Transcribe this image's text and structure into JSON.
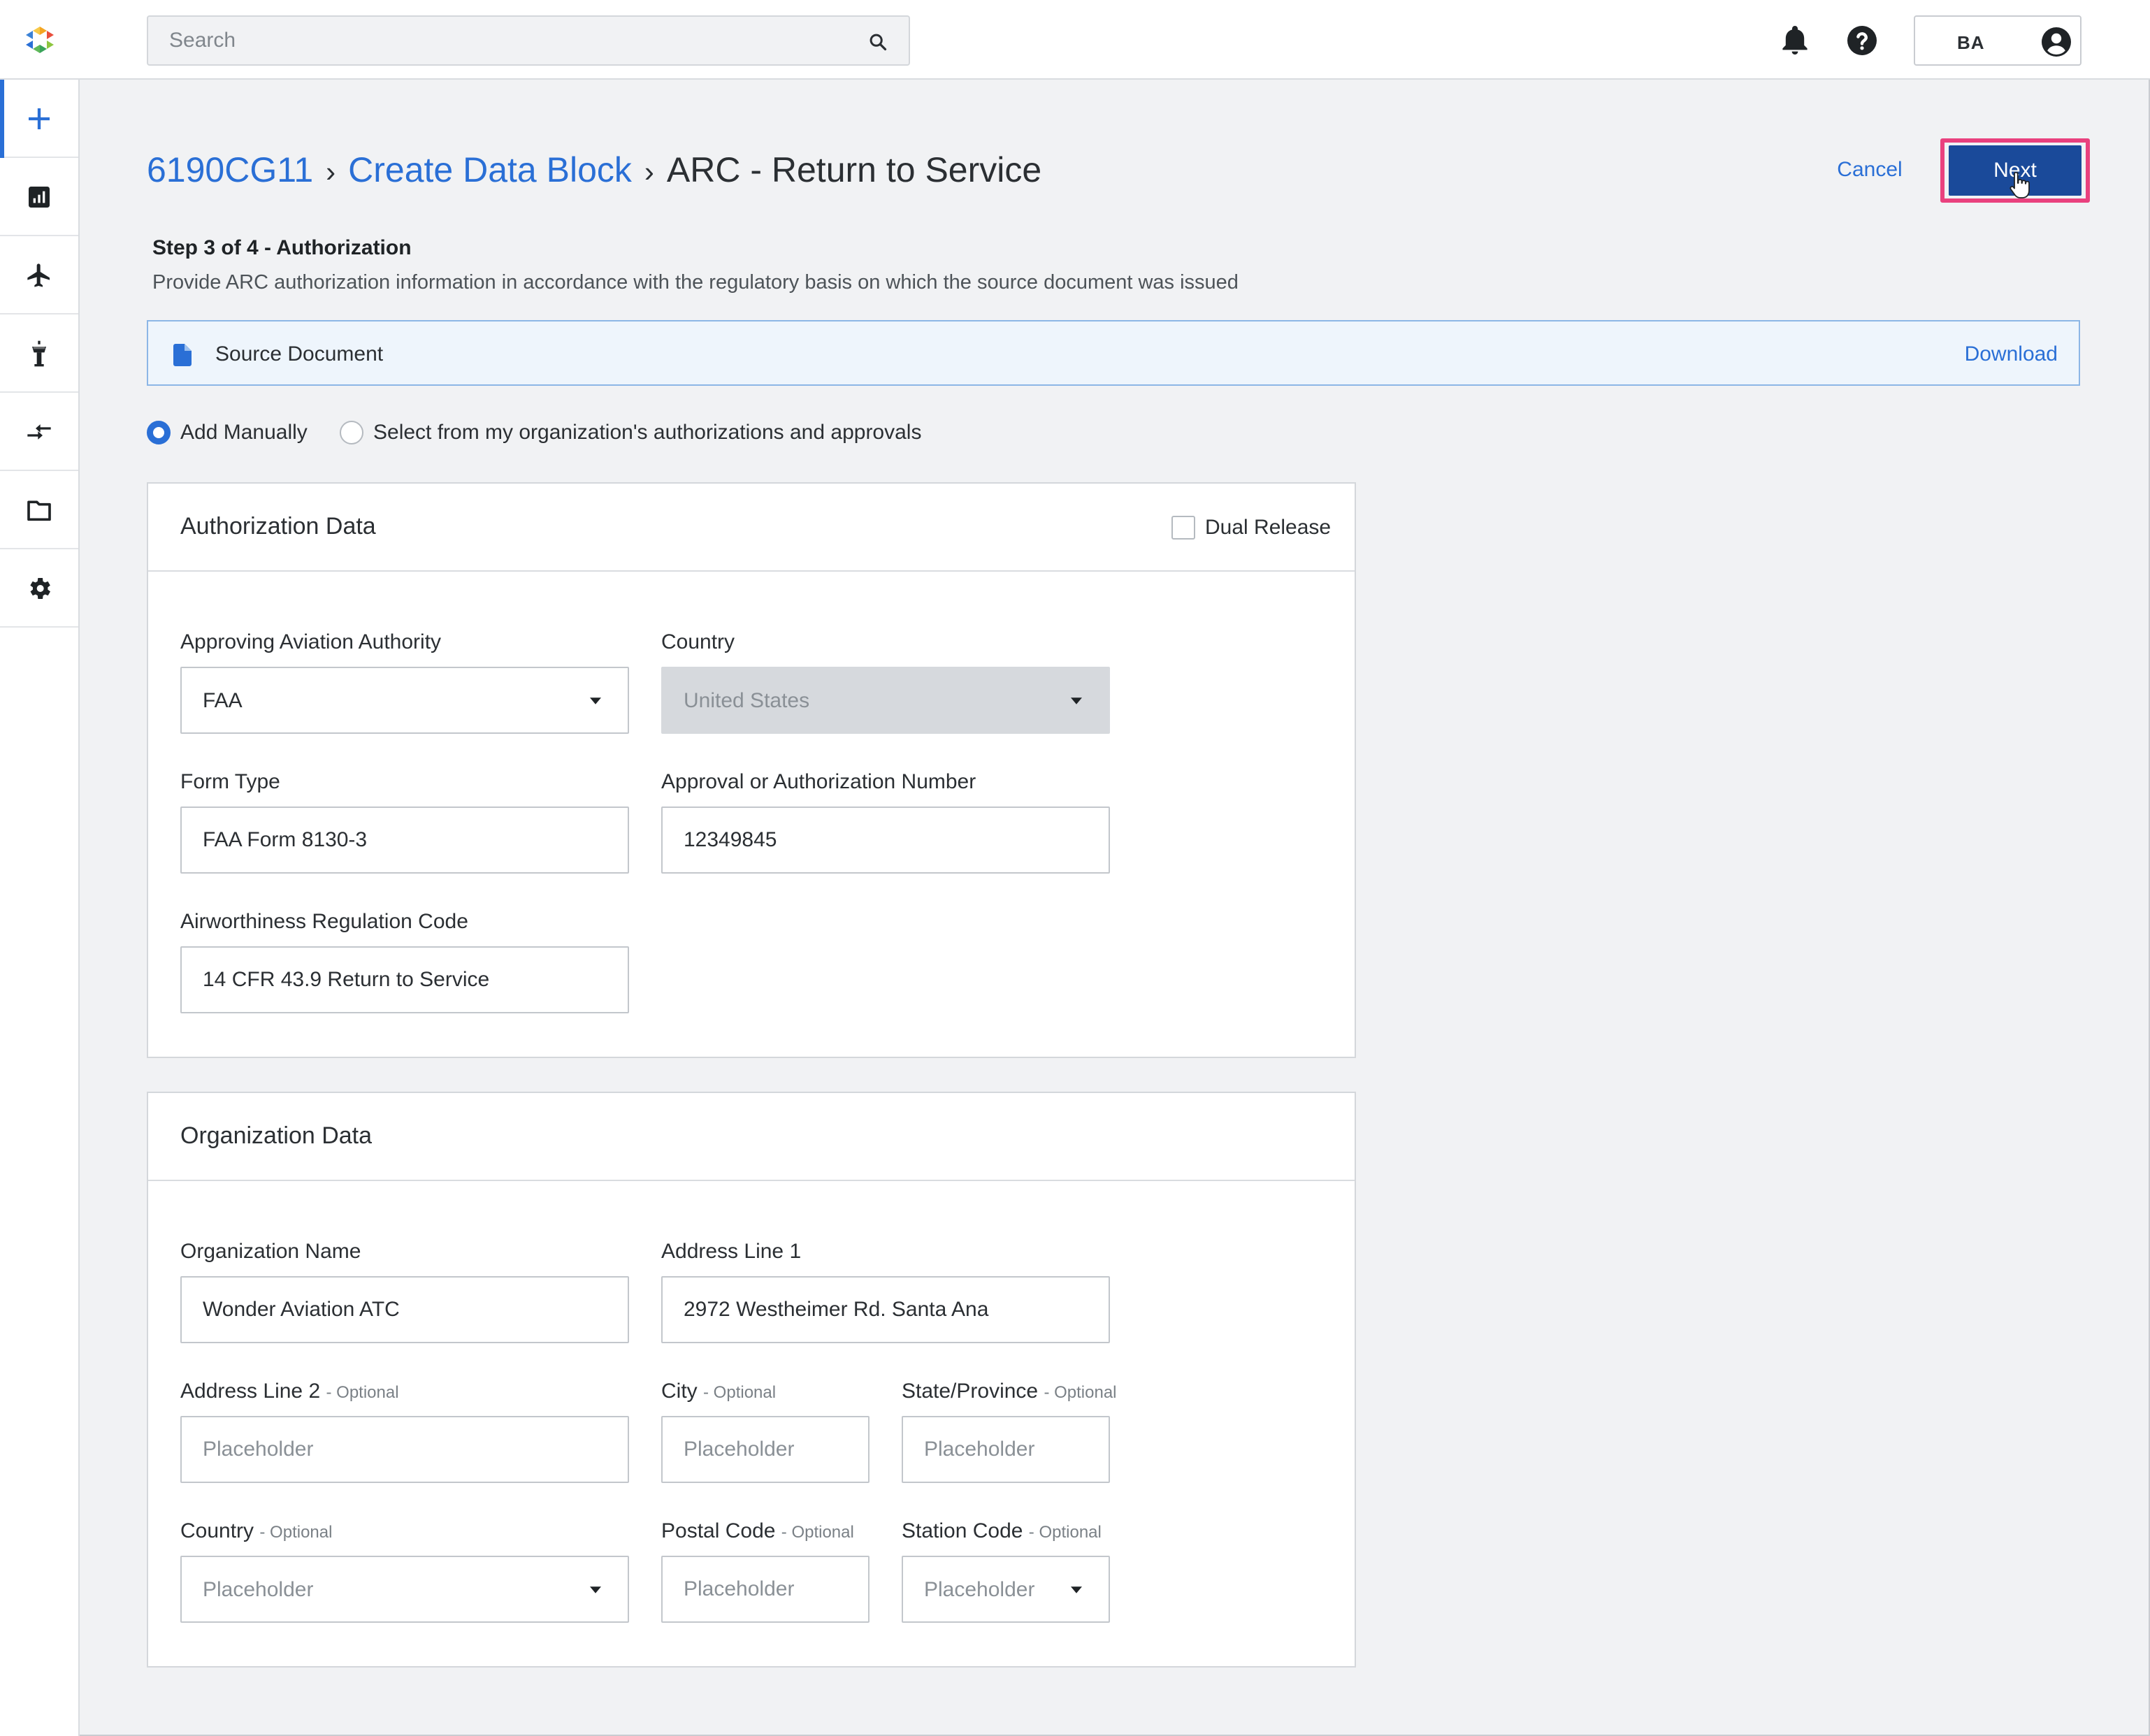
{
  "search": {
    "placeholder": "Search"
  },
  "user": {
    "initials": "BA"
  },
  "sidebar": {
    "items": [
      {
        "name": "create",
        "icon": "plus-icon",
        "active": true
      },
      {
        "name": "reports",
        "icon": "chart-icon"
      },
      {
        "name": "aircraft",
        "icon": "airplane-icon"
      },
      {
        "name": "tower",
        "icon": "control-tower-icon"
      },
      {
        "name": "transfers",
        "icon": "transfer-arrows-icon"
      },
      {
        "name": "folders",
        "icon": "folder-icon"
      },
      {
        "name": "settings",
        "icon": "gear-icon"
      }
    ]
  },
  "breadcrumb": {
    "item1": "6190CG11",
    "item2": "Create Data Block",
    "current": "ARC - Return to Service",
    "separator": "›"
  },
  "actions": {
    "cancel": "Cancel",
    "next": "Next"
  },
  "step": {
    "title": "Step 3 of 4 - Authorization",
    "description": "Provide ARC authorization information in accordance with the regulatory basis on which the source document was issued"
  },
  "source_document": {
    "label": "Source Document",
    "download": "Download"
  },
  "entry_mode": {
    "options": [
      {
        "label": "Add Manually",
        "checked": true
      },
      {
        "label": "Select from my organization's authorizations and approvals",
        "checked": false
      }
    ]
  },
  "authorization": {
    "title": "Authorization Data",
    "dual_release": "Dual Release",
    "authority_label": "Approving Aviation Authority",
    "authority_value": "FAA",
    "country_label": "Country",
    "country_value": "United States",
    "form_type_label": "Form Type",
    "form_type_value": "FAA Form 8130-3",
    "approval_number_label": "Approval or Authorization Number",
    "approval_number_value": "12349845",
    "regulation_code_label": "Airworthiness Regulation Code",
    "regulation_code_value": "14 CFR 43.9 Return to Service"
  },
  "organization": {
    "title": "Organization Data",
    "optional_tag": "- Optional",
    "placeholder": "Placeholder",
    "name_label": "Organization Name",
    "name_value": "Wonder Aviation ATC",
    "address1_label": "Address Line 1",
    "address1_value": "2972 Westheimer Rd. Santa Ana",
    "address2_label": "Address Line 2",
    "city_label": "City",
    "state_label": "State/Province",
    "country_label": "Country",
    "postal_label": "Postal Code",
    "station_label": "Station Code"
  },
  "colors": {
    "accent": "#2a6fd6",
    "primary_button": "#1a4a9a",
    "highlight": "#e9417e"
  }
}
